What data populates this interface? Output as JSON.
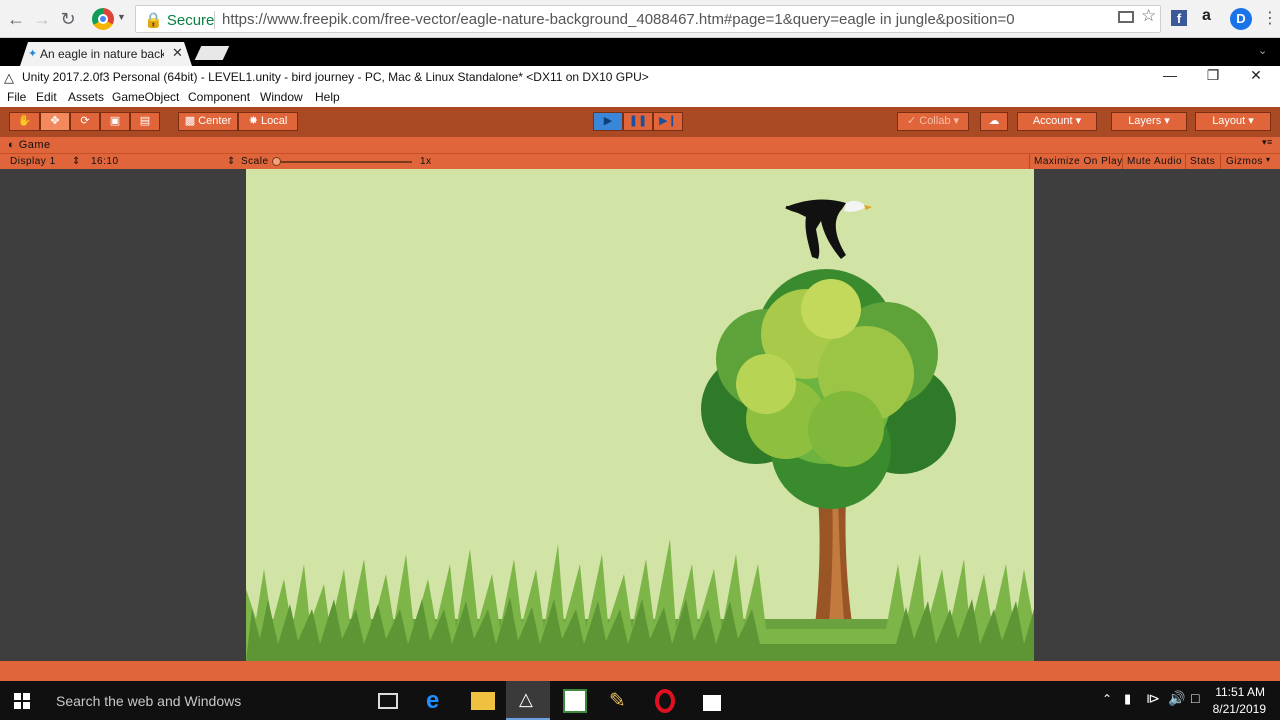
{
  "browser": {
    "secure_label": "Secure",
    "url": "https://www.freepik.com/free-vector/eagle-nature-background_4088467.htm#page=1&query=eagle in jungle&position=0",
    "tab_title": "An eagle in nature backg",
    "ext_amazon": "a"
  },
  "unity": {
    "window_title": "Unity 2017.2.0f3 Personal (64bit) - LEVEL1.unity - bird journey - PC, Mac & Linux Standalone* <DX11 on DX10 GPU>",
    "menu": [
      "File",
      "Edit",
      "Assets",
      "GameObject",
      "Component",
      "Window",
      "Help"
    ],
    "toolbar": {
      "pivot": "Center",
      "space": "Local",
      "collab": "Collab",
      "account": "Account",
      "layers": "Layers",
      "layout": "Layout"
    },
    "game_tab": "Game",
    "game_bar": {
      "display": "Display 1",
      "aspect": "16:10",
      "scale_label": "Scale",
      "scale_value": "1x",
      "maximize": "Maximize On Play",
      "mute": "Mute Audio",
      "stats": "Stats",
      "gizmos": "Gizmos"
    }
  },
  "taskbar": {
    "search_placeholder": "Search the web and Windows",
    "time": "11:51 AM",
    "date": "8/21/2019"
  },
  "colors": {
    "unity_toolbar": "#a94a24",
    "unity_panel": "#e0653a",
    "scene_bg": "#d1e4a5",
    "grass": "#6aa23f"
  }
}
